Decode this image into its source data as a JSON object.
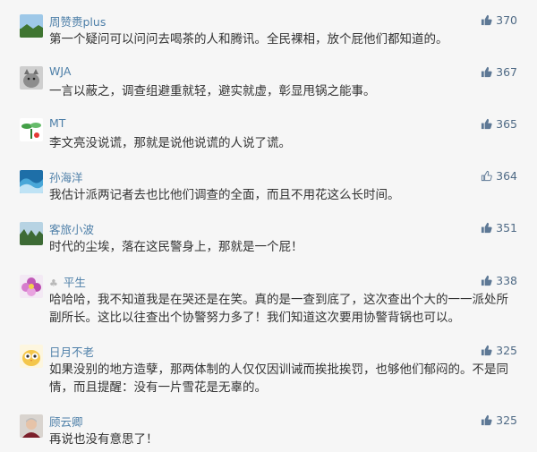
{
  "comments": [
    {
      "user": "周赞赉plus",
      "text": "第一个疑问可以问问去喝茶的人和腾讯。全民裸相，放个屁他们都知道的。",
      "likes": "370",
      "liked": true,
      "avatar_icon": "landscape-avatar-icon"
    },
    {
      "user": "WJA",
      "text": "一言以蔽之，调查组避重就轻，避实就虚，彰显甩锅之能事。",
      "likes": "367",
      "liked": true,
      "avatar_icon": "cat-avatar-icon"
    },
    {
      "user": "MT",
      "text": "李文亮没说谎，那就是说他说谎的人说了谎。",
      "likes": "365",
      "liked": true,
      "avatar_icon": "plant-avatar-icon"
    },
    {
      "user": "孙海洋",
      "text": "我估计派两记者去也比他们调查的全面，而且不用花这么长时间。",
      "likes": "364",
      "liked": false,
      "avatar_icon": "wave-avatar-icon"
    },
    {
      "user": "客旅小波",
      "text": "时代的尘埃，落在这民警身上，那就是一个屁！",
      "likes": "351",
      "liked": true,
      "avatar_icon": "forest-avatar-icon"
    },
    {
      "user": "平生",
      "flag": "♣",
      "text": "哈哈哈，我不知道我是在哭还是在笑。真的是一查到底了，这次查出个大的一一派处所副所长。这比以往查出个协警努力多了！我们知道这次要用协警背锅也可以。",
      "likes": "338",
      "liked": true,
      "avatar_icon": "flower-avatar-icon"
    },
    {
      "user": "日月不老",
      "text": "如果没别的地方造孽，那两体制的人仅仅因训诫而挨批挨罚，也够他们郁闷的。不是同情，而且提醒：没有一片雪花是无辜的。",
      "likes": "325",
      "liked": true,
      "avatar_icon": "owl-avatar-icon"
    },
    {
      "user": "顾云卿",
      "text": "再说也没有意思了！",
      "likes": "325",
      "liked": true,
      "avatar_icon": "portrait-avatar-icon"
    }
  ],
  "colors": {
    "name": "#4d7fa8",
    "text": "#333333",
    "likes": "#4f6a85",
    "background": "#f6f6f6"
  }
}
